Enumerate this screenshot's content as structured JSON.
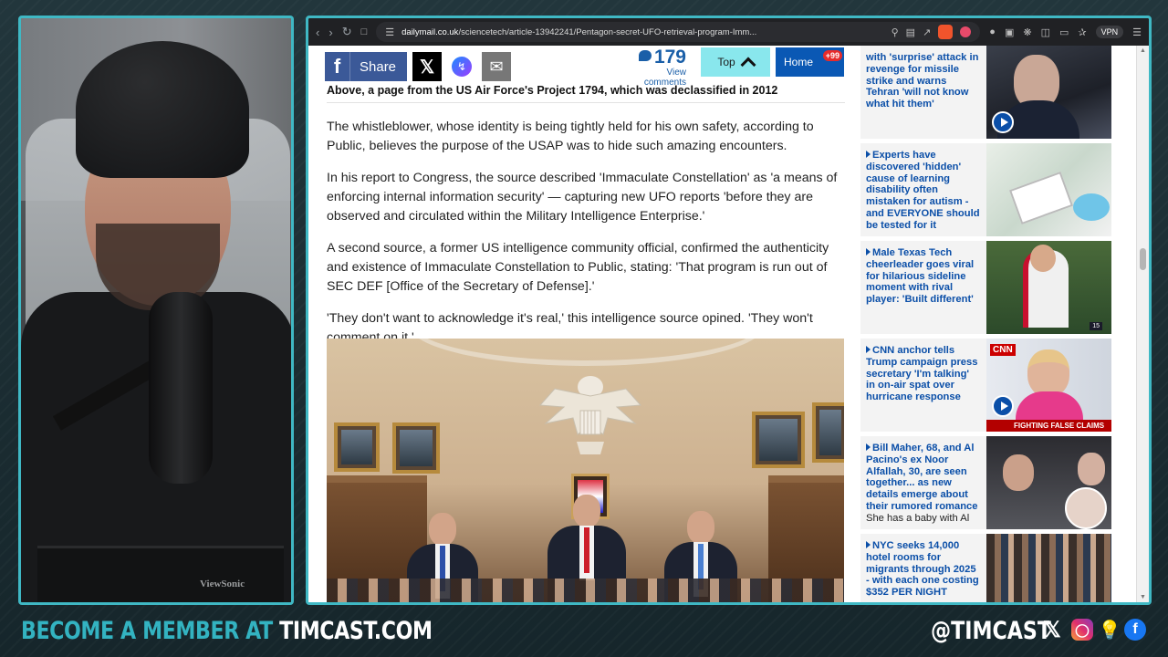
{
  "browser": {
    "url_domain": "dailymail.co.uk",
    "url_path": "/sciencetech/article-13942241/Pentagon-secret-UFO-retrieval-program-Imm...",
    "vpn_label": "VPN"
  },
  "sharebar": {
    "share_label": "Share",
    "comments_count": "179",
    "comments_label": "View comments",
    "top_label": "Top",
    "home_label": "Home",
    "home_badge": "+99"
  },
  "article": {
    "caption": "Above, a page from the US Air Force's Project 1794, which was declassified in 2012",
    "paragraphs": [
      "The whistleblower, whose identity is being tightly held for his own safety, according to Public, believes the purpose of the USAP was to hide such amazing encounters.",
      "In his report to Congress, the source described 'Immaculate Constellation' as 'a means of enforcing internal information security' — capturing new UFO reports 'before they are observed and circulated within the Military Intelligence Enterprise.'",
      "A second source, a former US intelligence community official, confirmed the authenticity and existence of Immaculate Constellation to Public, stating: 'That program is run out of SEC DEF [Office of the Secretary of Defense].'",
      "'They don't want to acknowledge it's real,' this intelligence source opined. 'They won't comment on it.'"
    ]
  },
  "sidebar": {
    "stories": [
      {
        "headline": "with 'surprise' attack in revenge for missile strike and warns Tehran 'will not know what hit them'",
        "sub": ""
      },
      {
        "headline": "Experts have discovered 'hidden' cause of learning disability often mistaken for autism - and EVERYONE should be tested for it",
        "sub": ""
      },
      {
        "headline": "Male Texas Tech cheerleader goes viral for hilarious sideline moment with rival player: 'Built different'",
        "sub": ""
      },
      {
        "headline": "CNN anchor tells Trump campaign press secretary 'I'm talking' in on-air spat over hurricane response",
        "sub": ""
      },
      {
        "headline": "Bill Maher, 68, and Al Pacino's ex Noor Alfallah, 30, are seen together... as new details emerge about their rumored romance",
        "sub": "She has a baby with Al"
      },
      {
        "headline": "NYC seeks 14,000 hotel rooms for migrants through 2025 - with each one costing $352 PER NIGHT",
        "sub": ""
      }
    ],
    "cnn_logo": "CNN",
    "ticker": "FIGHTING FALSE CLAIMS"
  },
  "overlay": {
    "member_prefix": "BECOME A MEMBER AT",
    "member_site": "TIMCAST.COM",
    "handle": "@TIMCAST",
    "webcam_monitor_brand": "ViewSonic"
  },
  "colors": {
    "accent": "#3fb8c4",
    "dailymail_blue": "#0b4fa8",
    "facebook": "#3b5998"
  }
}
